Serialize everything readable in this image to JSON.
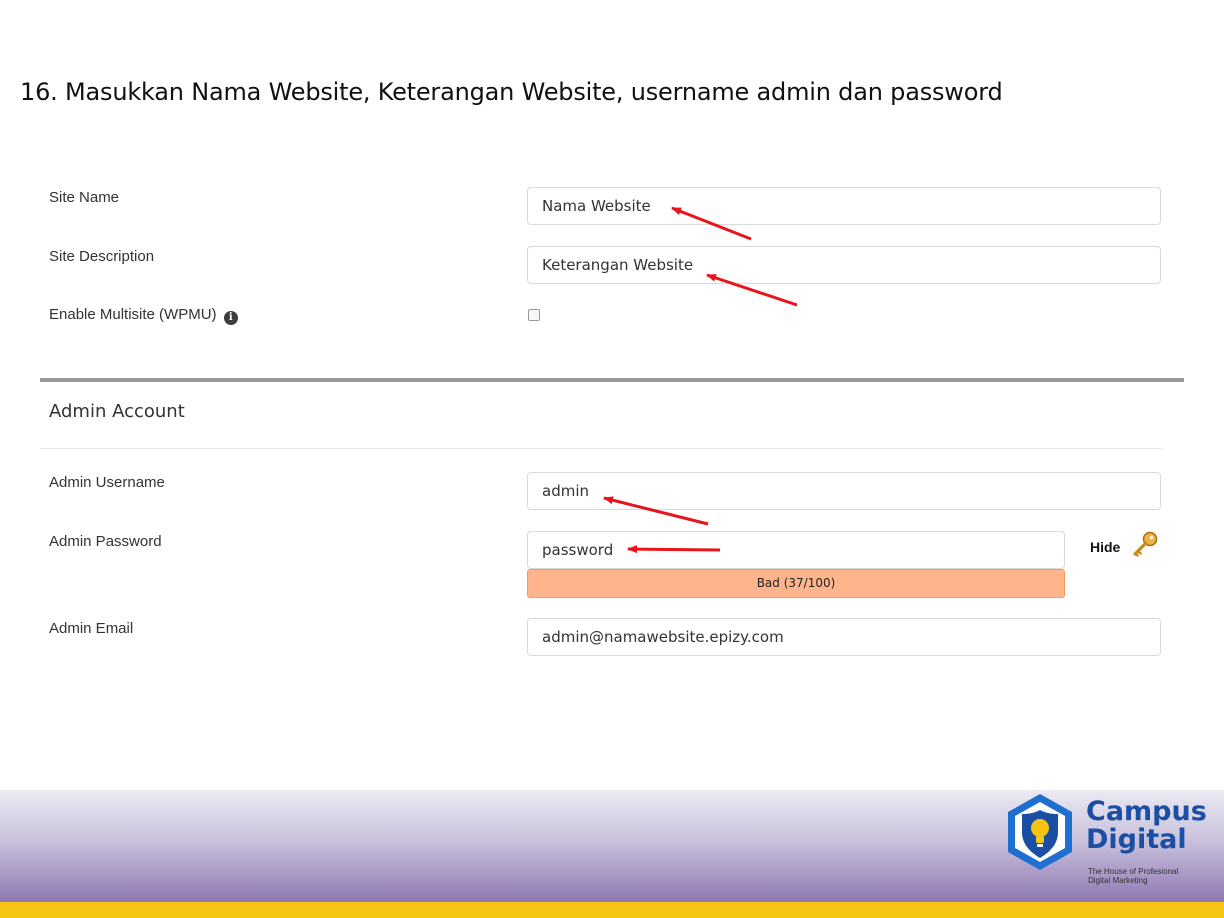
{
  "heading": "16. Masukkan Nama Website, Keterangan Website, username admin dan password",
  "form": {
    "site_name": {
      "label": "Site Name",
      "value": "Nama Website"
    },
    "site_description": {
      "label": "Site Description",
      "value": "Keterangan Website"
    },
    "multisite": {
      "label": "Enable Multisite (WPMU)",
      "checked": false,
      "info_icon": "info-icon"
    }
  },
  "admin": {
    "section_title": "Admin Account",
    "username": {
      "label": "Admin Username",
      "value": "admin"
    },
    "password": {
      "label": "Admin Password",
      "value": "password",
      "hide_label": "Hide",
      "strength_text": "Bad (37/100)",
      "strength_score": 37
    },
    "email": {
      "label": "Admin Email",
      "value": "admin@namawebsite.epizy.com"
    }
  },
  "footer": {
    "brand_line1": "Campus",
    "brand_line2": "Digital",
    "tagline_line1": "The House of Profesional",
    "tagline_line2": "Digital Marketing"
  },
  "colors": {
    "strength_bar": "#ffb48c",
    "arrow": "#e8141b",
    "brand_blue": "#1a4fa3",
    "footer_accent": "#f6c514"
  }
}
